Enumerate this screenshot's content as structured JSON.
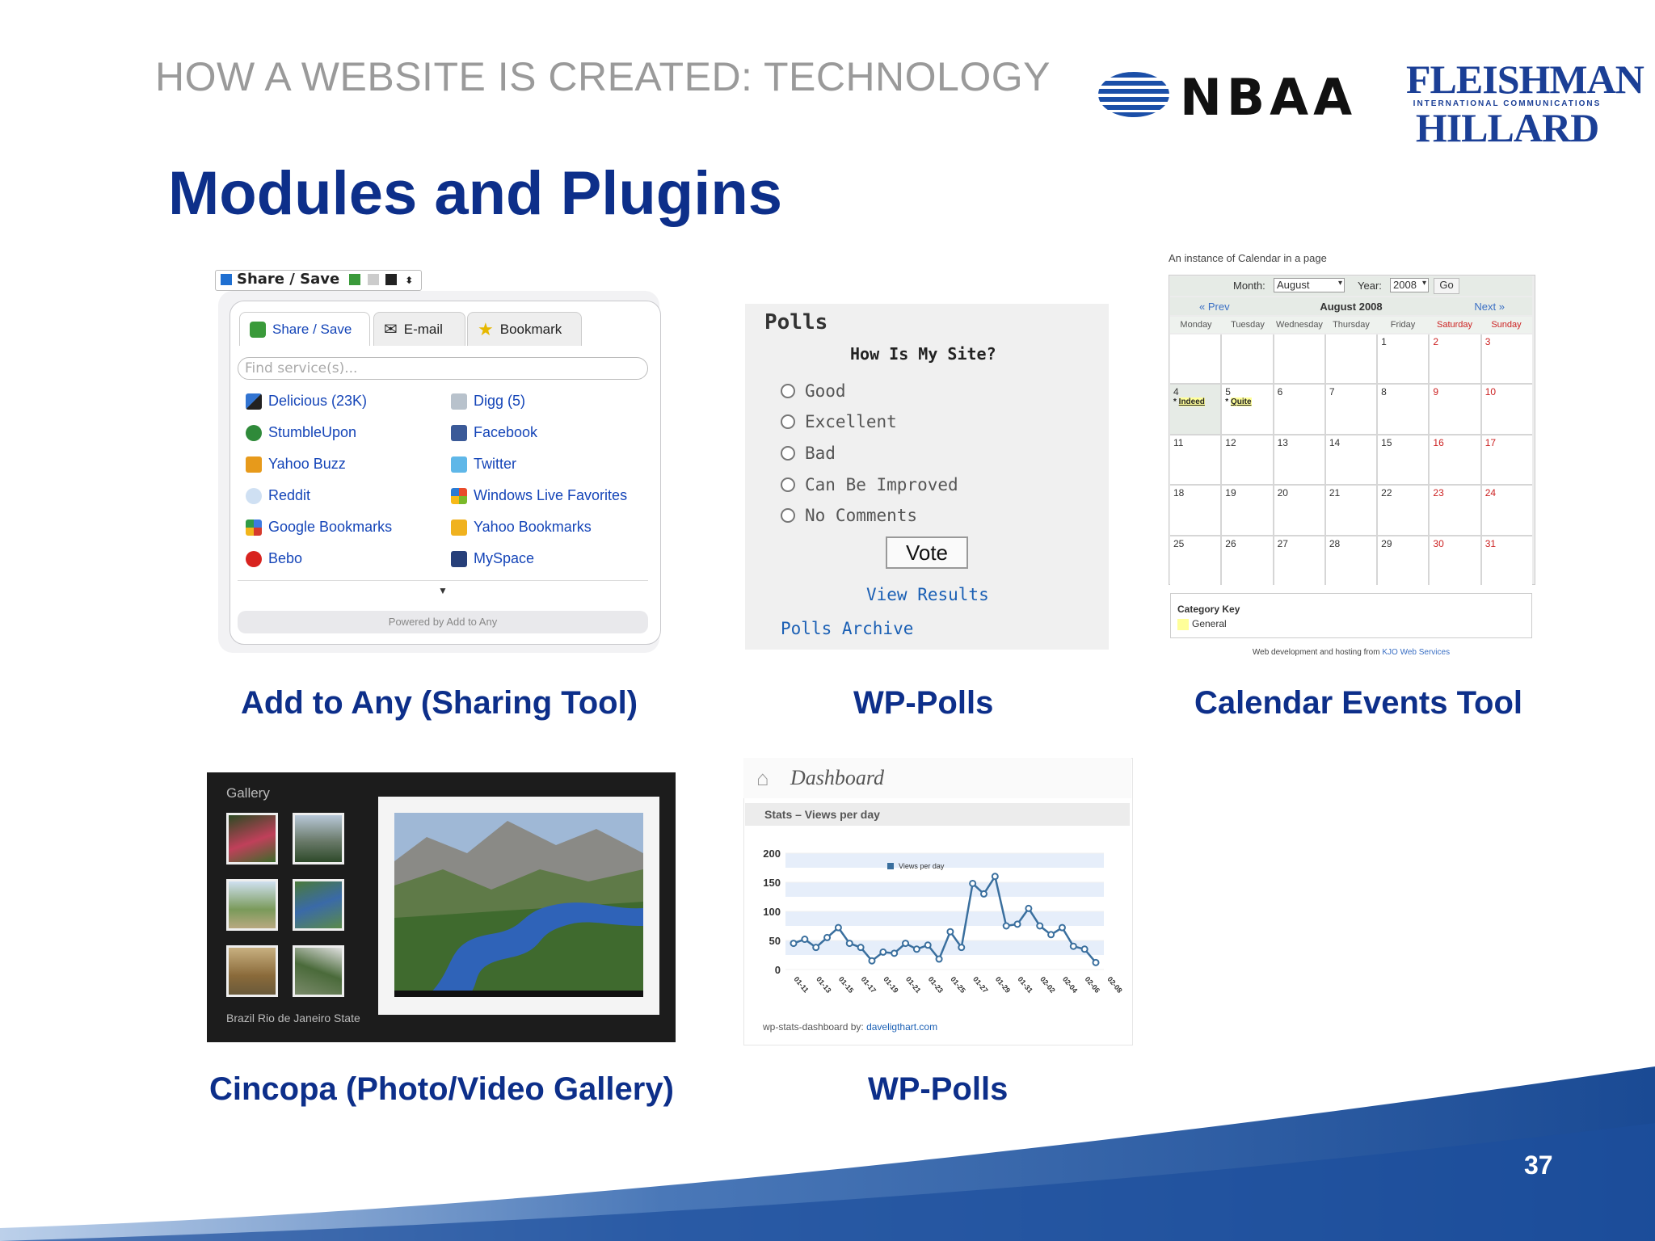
{
  "header": {
    "title": "HOW A WEBSITE IS CREATED: TECHNOLOGY"
  },
  "logos": {
    "nbaa": "NBAA",
    "fh_line1": "FLEISHMAN",
    "fh_mid": "INTERNATIONAL COMMUNICATIONS",
    "fh_line2": "HILLARD"
  },
  "slide": {
    "title": "Modules and Plugins",
    "page_number": "37"
  },
  "captions": {
    "addtoany": "Add to Any (Sharing Tool)",
    "wppolls1": "WP-Polls",
    "calendar": "Calendar Events Tool",
    "cincopa": "Cincopa (Photo/Video Gallery)",
    "wppolls2": "WP-Polls"
  },
  "addtoany": {
    "button_label": "Share / Save",
    "tabs": [
      "Share / Save",
      "E-mail",
      "Bookmark"
    ],
    "find_placeholder": "Find service(s)...",
    "services_left": [
      "Delicious (23K)",
      "StumbleUpon",
      "Yahoo Buzz",
      "Reddit",
      "Google Bookmarks",
      "Bebo"
    ],
    "services_right": [
      "Digg (5)",
      "Facebook",
      "Twitter",
      "Windows Live Favorites",
      "Yahoo Bookmarks",
      "MySpace"
    ],
    "powered_by": "Powered by Add to Any",
    "colors": {
      "accent": "#1545b8"
    }
  },
  "polls": {
    "title": "Polls",
    "question": "How Is My Site?",
    "options": [
      "Good",
      "Excellent",
      "Bad",
      "Can Be Improved",
      "No Comments"
    ],
    "vote_label": "Vote",
    "view_results": "View Results",
    "archive": "Polls Archive"
  },
  "calendar": {
    "caption": "An instance of Calendar in a page",
    "month_label": "Month:",
    "month_value": "August",
    "year_label": "Year:",
    "year_value": "2008",
    "go_label": "Go",
    "prev": "« Prev",
    "next": "Next »",
    "title": "August 2008",
    "days": [
      "Monday",
      "Tuesday",
      "Wednesday",
      "Thursday",
      "Friday",
      "Saturday",
      "Sunday"
    ],
    "weeks": [
      [
        "",
        "",
        "",
        "",
        "1",
        "2",
        "3"
      ],
      [
        "4",
        "5",
        "6",
        "7",
        "8",
        "9",
        "10"
      ],
      [
        "11",
        "12",
        "13",
        "14",
        "15",
        "16",
        "17"
      ],
      [
        "18",
        "19",
        "20",
        "21",
        "22",
        "23",
        "24"
      ],
      [
        "25",
        "26",
        "27",
        "28",
        "29",
        "30",
        "31"
      ]
    ],
    "events": {
      "4": "Indeed",
      "5": "Quite"
    },
    "key_title": "Category Key",
    "key_item": "General",
    "credit_text": "Web development and hosting from ",
    "credit_link": "KJO Web Services"
  },
  "gallery": {
    "title": "Gallery",
    "footer": "Brazil Rio de Janeiro State"
  },
  "dashboard": {
    "title": "Dashboard",
    "bar": "Stats – Views per day",
    "footer_text": "wp-stats-dashboard by: ",
    "footer_link": "daveligthart.com"
  },
  "chart_data": {
    "type": "line",
    "legend": "Views per day",
    "ylim": [
      0,
      200
    ],
    "yticks": [
      0,
      50,
      100,
      150,
      200
    ],
    "xticks": [
      "01-11",
      "01-13",
      "01-15",
      "01-17",
      "01-19",
      "01-21",
      "01-23",
      "01-25",
      "01-27",
      "01-29",
      "01-31",
      "02-02",
      "02-04",
      "02-06",
      "02-08"
    ],
    "series": [
      {
        "name": "Views per day",
        "values": [
          45,
          52,
          38,
          55,
          72,
          45,
          38,
          15,
          30,
          28,
          45,
          35,
          42,
          18,
          65,
          38,
          148,
          130,
          160,
          75,
          78,
          105,
          75,
          60,
          72,
          40,
          35,
          12
        ]
      }
    ],
    "colors": {
      "line": "#3a6f9e",
      "band": "#e6eefa"
    }
  }
}
